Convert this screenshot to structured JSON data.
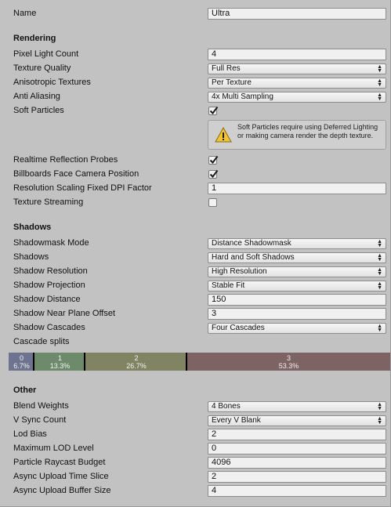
{
  "name": {
    "label": "Name",
    "value": "Ultra"
  },
  "rendering": {
    "header": "Rendering",
    "pixel_light_count": {
      "label": "Pixel Light Count",
      "value": "4"
    },
    "texture_quality": {
      "label": "Texture Quality",
      "value": "Full Res"
    },
    "anisotropic_textures": {
      "label": "Anisotropic Textures",
      "value": "Per Texture"
    },
    "anti_aliasing": {
      "label": "Anti Aliasing",
      "value": "4x Multi Sampling"
    },
    "soft_particles": {
      "label": "Soft Particles",
      "checked": true
    },
    "soft_particles_help": "Soft Particles require using Deferred Lighting or making camera render the depth texture.",
    "realtime_reflection_probes": {
      "label": "Realtime Reflection Probes",
      "checked": true
    },
    "billboards_face_camera": {
      "label": "Billboards Face Camera Position",
      "checked": true
    },
    "resolution_scaling": {
      "label": "Resolution Scaling Fixed DPI Factor",
      "value": "1"
    },
    "texture_streaming": {
      "label": "Texture Streaming",
      "checked": false
    }
  },
  "shadows": {
    "header": "Shadows",
    "shadowmask_mode": {
      "label": "Shadowmask Mode",
      "value": "Distance Shadowmask"
    },
    "shadows": {
      "label": "Shadows",
      "value": "Hard and Soft Shadows"
    },
    "shadow_resolution": {
      "label": "Shadow Resolution",
      "value": "High Resolution"
    },
    "shadow_projection": {
      "label": "Shadow Projection",
      "value": "Stable Fit"
    },
    "shadow_distance": {
      "label": "Shadow Distance",
      "value": "150"
    },
    "shadow_near_plane_offset": {
      "label": "Shadow Near Plane Offset",
      "value": "3"
    },
    "shadow_cascades": {
      "label": "Shadow Cascades",
      "value": "Four Cascades"
    },
    "cascade_splits_label": "Cascade splits",
    "cascade_splits": [
      {
        "index": "0",
        "percent": "6.7%",
        "fraction": 0.067,
        "color": "#6e7390"
      },
      {
        "index": "1",
        "percent": "13.3%",
        "fraction": 0.133,
        "color": "#6d8b6b"
      },
      {
        "index": "2",
        "percent": "26.7%",
        "fraction": 0.267,
        "color": "#808463"
      },
      {
        "index": "3",
        "percent": "53.3%",
        "fraction": 0.533,
        "color": "#7d6363"
      }
    ]
  },
  "other": {
    "header": "Other",
    "blend_weights": {
      "label": "Blend Weights",
      "value": "4 Bones"
    },
    "vsync_count": {
      "label": "V Sync Count",
      "value": "Every V Blank"
    },
    "lod_bias": {
      "label": "Lod Bias",
      "value": "2"
    },
    "maximum_lod_level": {
      "label": "Maximum LOD Level",
      "value": "0"
    },
    "particle_raycast_budget": {
      "label": "Particle Raycast Budget",
      "value": "4096"
    },
    "async_upload_time_slice": {
      "label": "Async Upload Time Slice",
      "value": "2"
    },
    "async_upload_buffer_size": {
      "label": "Async Upload Buffer Size",
      "value": "4"
    }
  },
  "icons": {
    "warning": "warning-icon",
    "checkmark": "checkmark-icon",
    "dropdown_arrow": "dropdown-arrow-icon"
  }
}
